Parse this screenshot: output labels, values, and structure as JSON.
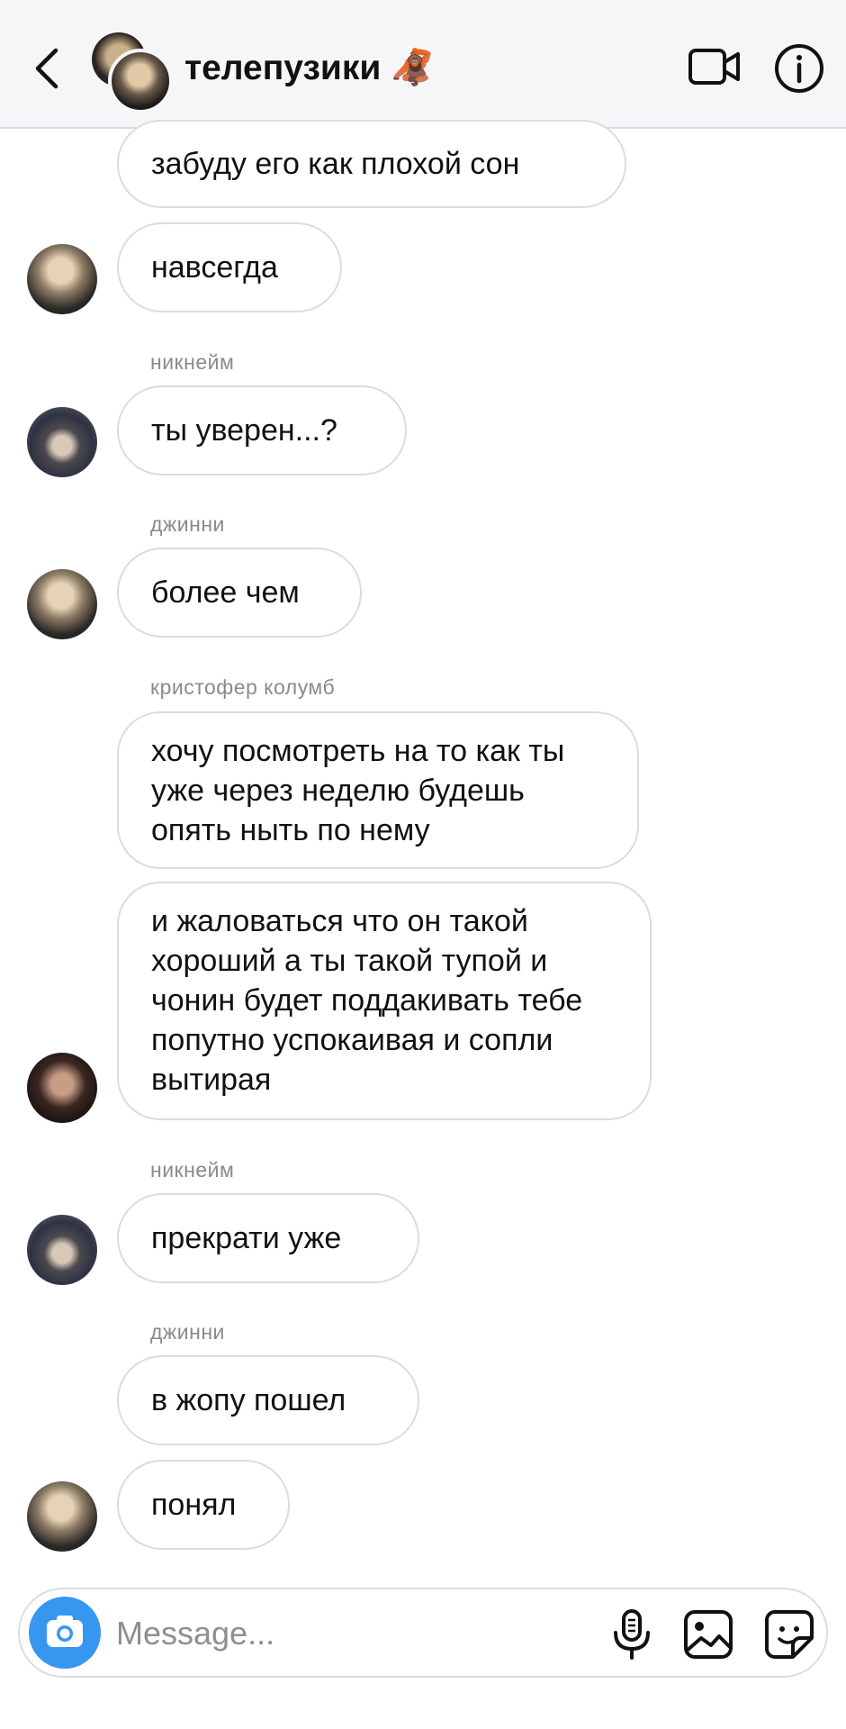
{
  "header": {
    "title": "телепузики 🦧",
    "icons": {
      "back": "chevron-left-icon",
      "video": "video-camera-icon",
      "info": "info-icon"
    }
  },
  "messages": [
    {
      "text": "забуду его как плохой сон"
    },
    {
      "text": "навсегда"
    },
    {
      "sender": "никнейм",
      "text": "ты уверен...?"
    },
    {
      "sender": "джинни",
      "text": "более чем"
    },
    {
      "sender": "кристофер колумб",
      "text": "хочу посмотреть на то как ты уже через неделю будешь опять ныть по нему"
    },
    {
      "text": "и жаловаться что он такой хороший а ты такой тупой и чонин будет поддакивать тебе попутно успокаивая и сопли вытирая"
    },
    {
      "sender": "никнейм",
      "text": "прекрати уже"
    },
    {
      "sender": "джинни",
      "text": "в жопу пошел"
    },
    {
      "text": "понял"
    }
  ],
  "composer": {
    "placeholder": "Message...",
    "icons": {
      "camera": "camera-icon",
      "mic": "microphone-icon",
      "gallery": "gallery-icon",
      "sticker": "sticker-icon"
    }
  },
  "colors": {
    "accent": "#3797f0",
    "bubble_border": "#dcdcdf",
    "header_bg": "#f6f6f8",
    "sender_label": "#8a8a8e"
  }
}
